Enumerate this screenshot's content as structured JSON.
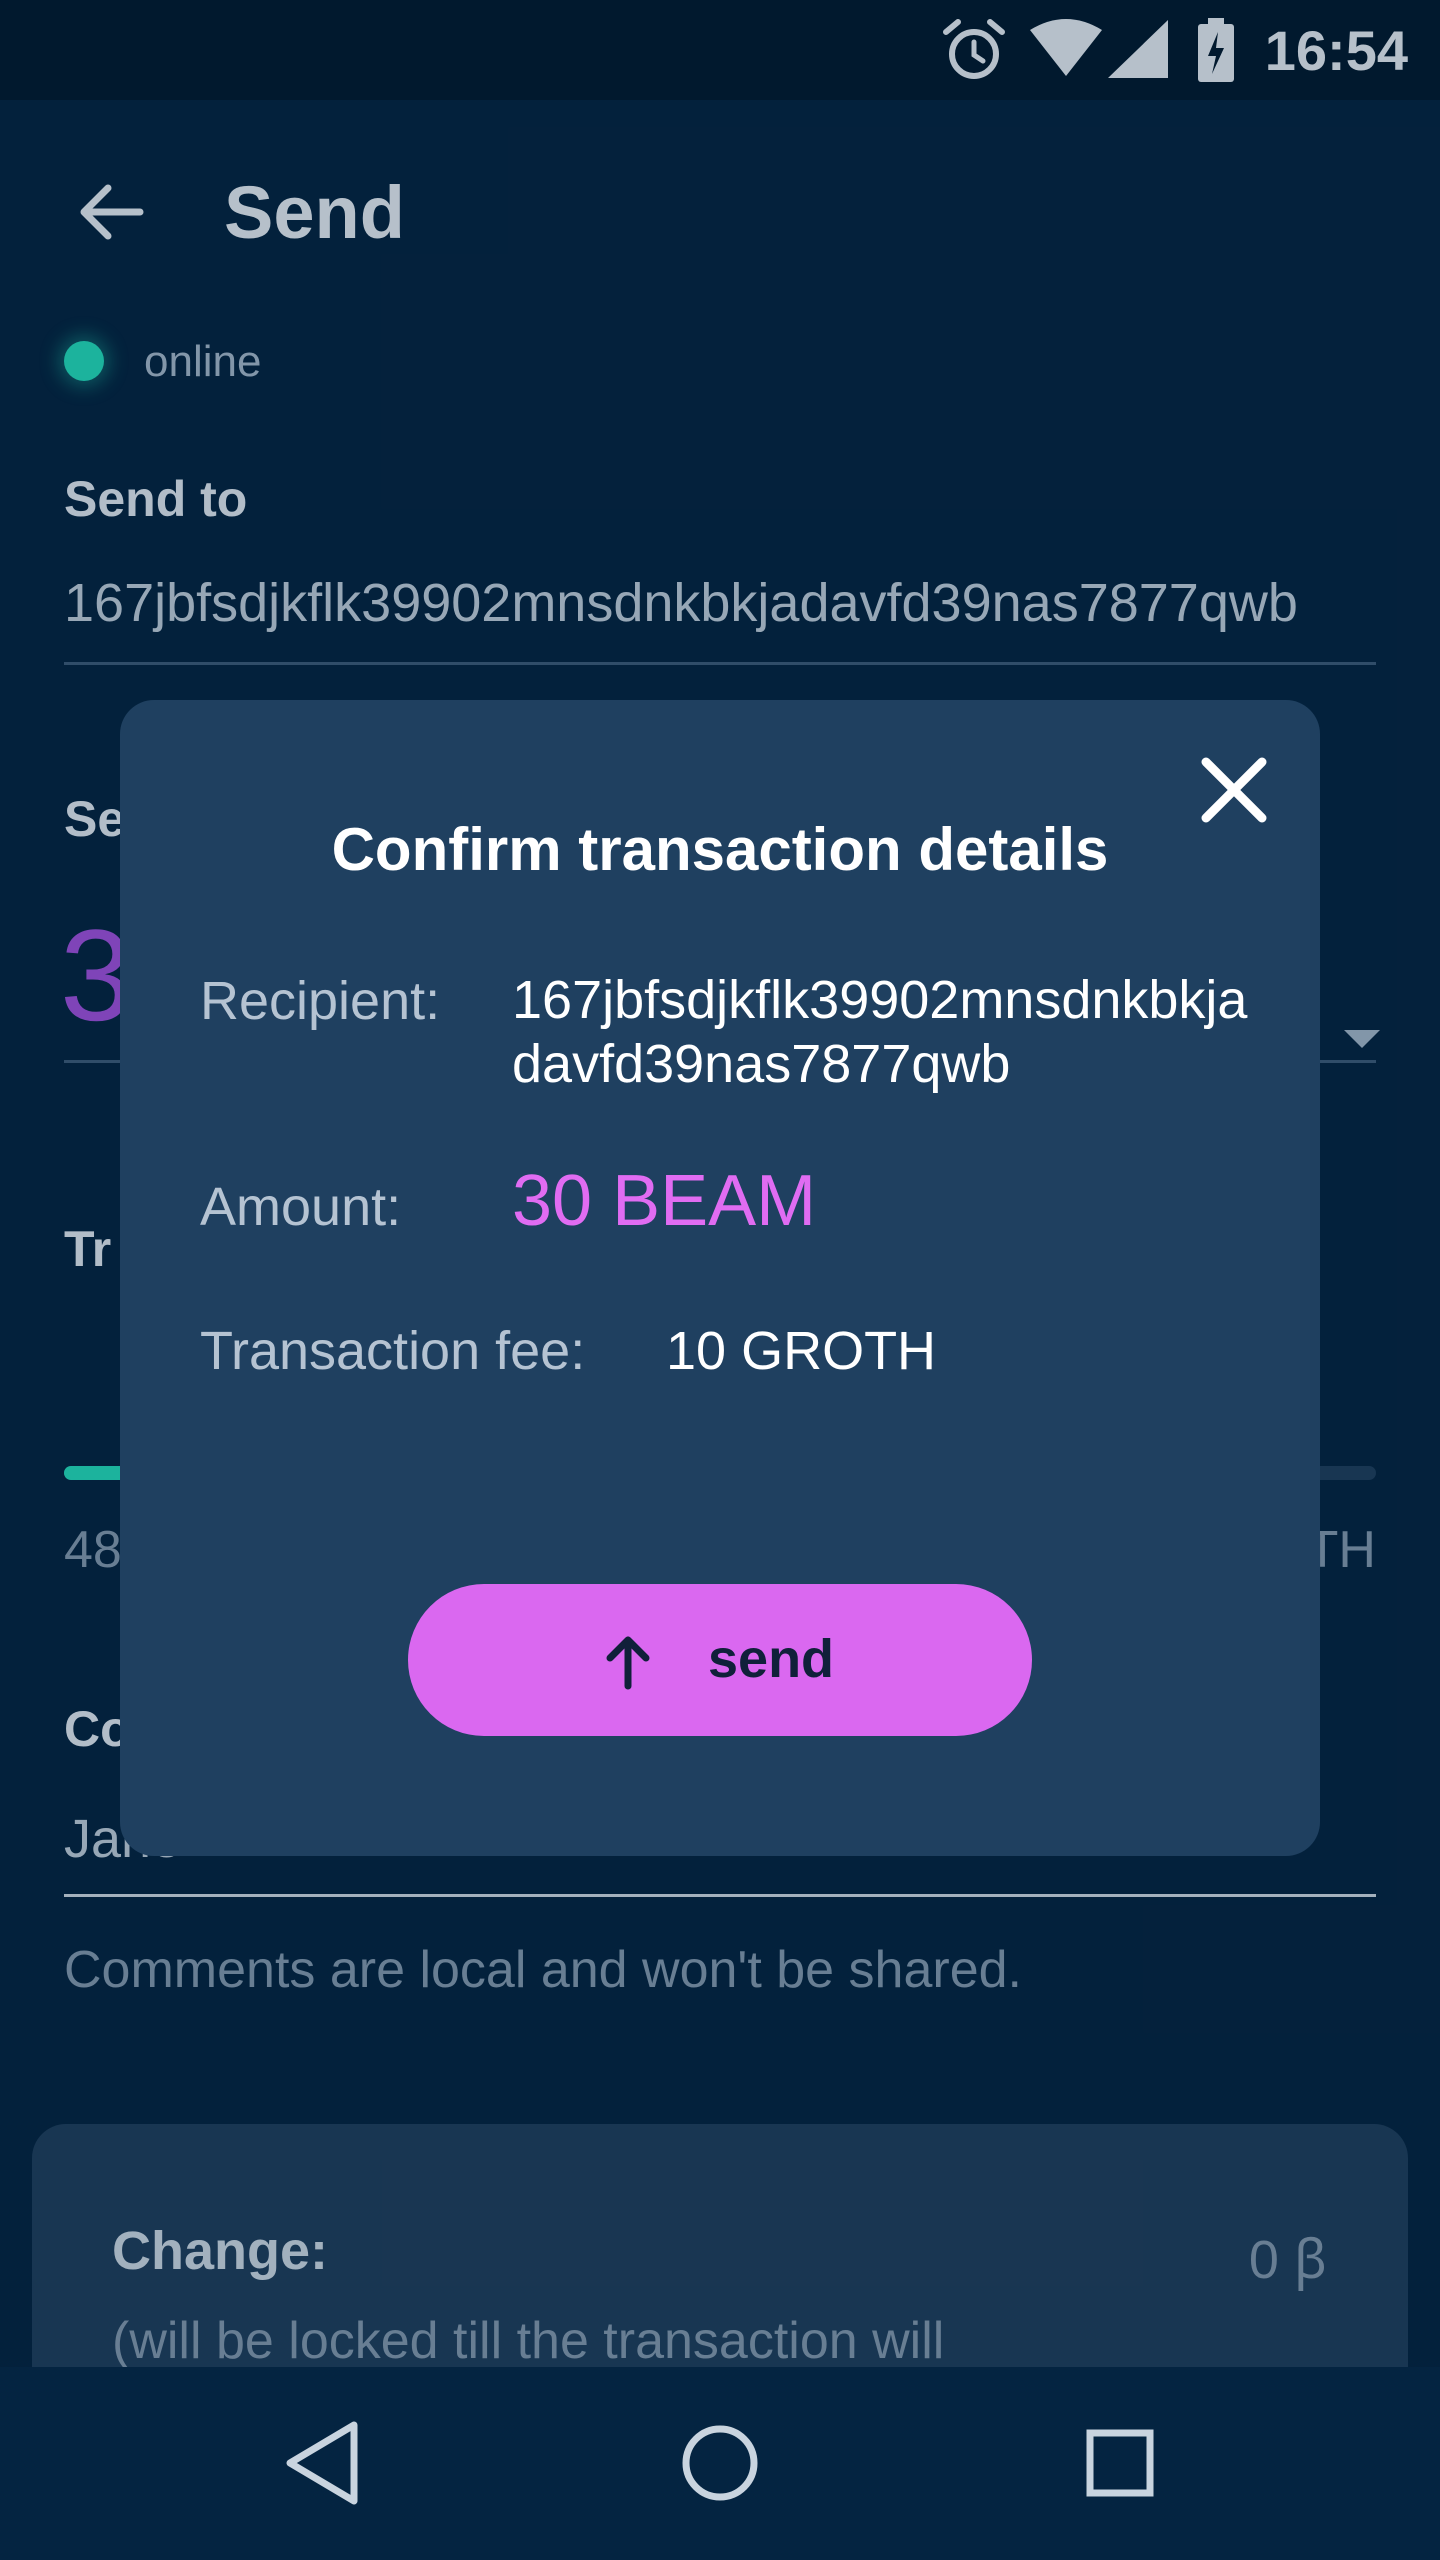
{
  "status_bar": {
    "time": "16:54",
    "icons": [
      "alarm-icon",
      "wifi-icon",
      "signal-icon",
      "battery-charging-icon"
    ]
  },
  "header": {
    "title": "Send",
    "back_icon": "arrow-back-icon"
  },
  "connection": {
    "status": "online",
    "color": "#23d6b8"
  },
  "form": {
    "send_to_label": "Send to",
    "address": "167jbfsdjkflk39902mnsdnkbkjadavfd39nas7877qwb",
    "send_amount_label_partial": "Se",
    "amount_partial": "3",
    "fee_label_partial": "Tr",
    "slider_min_partial": "48",
    "slider_max_partial": "TH",
    "comment_label_partial": "Co",
    "comment_partial": "Jane",
    "comment_hint": "Comments are local and won't be shared."
  },
  "change": {
    "label": "Change:",
    "note": "(will be locked till the transaction will succeed or expire)",
    "amount": "0",
    "currency_symbol": "ꞵ"
  },
  "dialog": {
    "title": "Confirm transaction details",
    "recipient_label": "Recipient:",
    "recipient_value": "167jbfsdjkflk39902mnsdnkbkjadavfd39nas7877qwb",
    "amount_label": "Amount:",
    "amount_value": "30 BEAM",
    "fee_label": "Transaction fee:",
    "fee_value": "10 GROTH",
    "send_button_label": "send",
    "close_icon": "close-icon",
    "send_icon": "arrow-up-icon"
  },
  "colors": {
    "background": "#042441",
    "dialog": "#1f4060",
    "accent_purple": "#da68f0",
    "amount_purple": "#e06cf2",
    "online_green": "#23d6b8"
  },
  "nav": {
    "icons": [
      "nav-back-icon",
      "nav-home-icon",
      "nav-recents-icon"
    ]
  }
}
